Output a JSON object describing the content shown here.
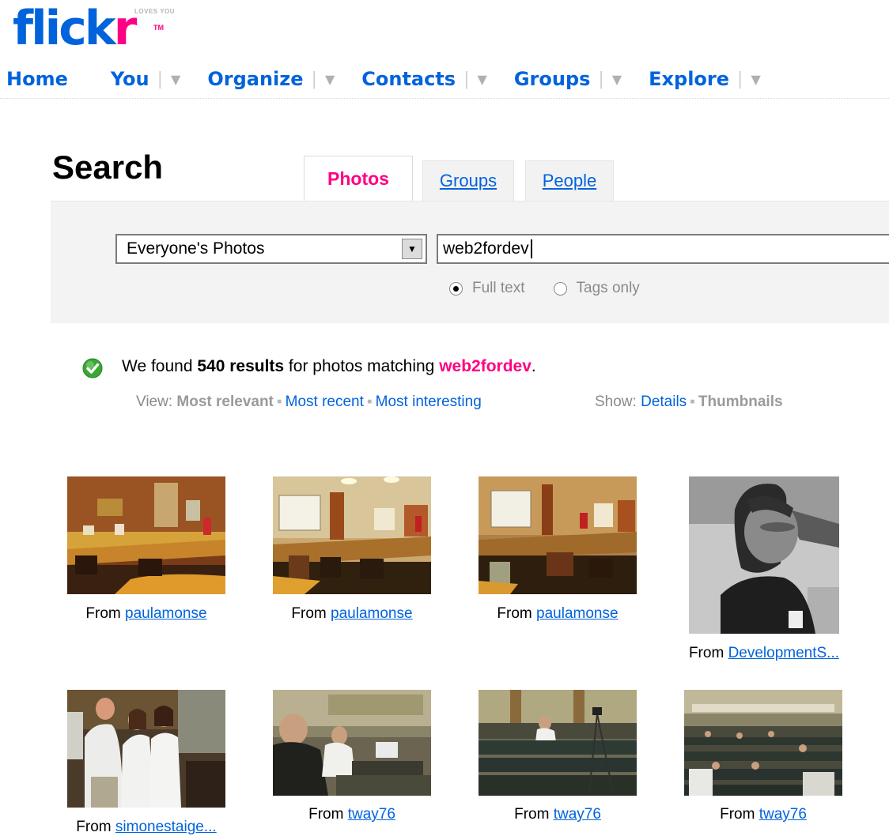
{
  "brand": {
    "logo_main": "flick",
    "logo_accent": "r",
    "logo_tagline": "LOVES YOU",
    "logo_tm": "TM"
  },
  "nav": {
    "home": "Home",
    "you": "You",
    "organize": "Organize",
    "contacts": "Contacts",
    "groups": "Groups",
    "explore": "Explore",
    "menu_separator": "|",
    "menu_arrow": "▼"
  },
  "search": {
    "title": "Search",
    "tabs": [
      {
        "label": "Photos",
        "active": true
      },
      {
        "label": "Groups",
        "active": false
      },
      {
        "label": "People",
        "active": false
      }
    ],
    "scope_value": "Everyone's Photos",
    "dropdown_arrow": "▼",
    "query_value": "web2fordev",
    "radio_full_text": "Full text",
    "radio_tags_only": "Tags only",
    "selected_mode": "full_text"
  },
  "results": {
    "prefix": "We found ",
    "count": "540 results",
    "middle": " for photos matching ",
    "query": "web2fordev",
    "suffix": ".",
    "view_label": "View:",
    "view_relevant": "Most relevant",
    "view_recent": "Most recent",
    "view_interesting": "Most interesting",
    "show_label": "Show:",
    "show_details": "Details",
    "show_thumbnails": "Thumbnails",
    "separator": "▪"
  },
  "photos": [
    {
      "from": "From",
      "user": "paulamonse"
    },
    {
      "from": "From",
      "user": "paulamonse"
    },
    {
      "from": "From",
      "user": "paulamonse"
    },
    {
      "from": "From",
      "user": "DevelopmentS..."
    },
    {
      "from": "From",
      "user": "simonestaige..."
    },
    {
      "from": "From",
      "user": "tway76"
    },
    {
      "from": "From",
      "user": "tway76"
    },
    {
      "from": "From",
      "user": "tway76"
    }
  ],
  "colors": {
    "brand_blue": "#0063dc",
    "brand_pink": "#ff0084",
    "success_green": "#3aa833"
  }
}
